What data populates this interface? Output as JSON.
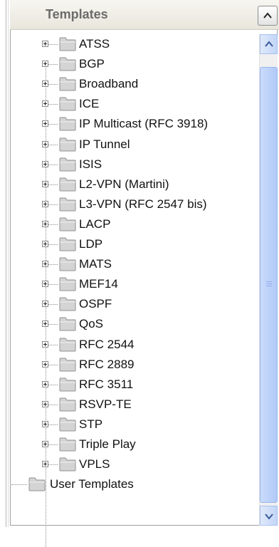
{
  "panel": {
    "title": "Templates",
    "collapse_icon": "chevron-up-icon"
  },
  "tree": {
    "items": [
      {
        "label": "ATSS",
        "icon": "folder-icon",
        "expander": "expand-plus-icon"
      },
      {
        "label": "BGP",
        "icon": "folder-icon",
        "expander": "expand-plus-icon"
      },
      {
        "label": "Broadband",
        "icon": "folder-icon",
        "expander": "expand-plus-icon"
      },
      {
        "label": "ICE",
        "icon": "folder-icon",
        "expander": "expand-plus-icon"
      },
      {
        "label": "IP Multicast (RFC 3918)",
        "icon": "folder-icon",
        "expander": "expand-plus-icon"
      },
      {
        "label": "IP Tunnel",
        "icon": "folder-icon",
        "expander": "expand-plus-icon"
      },
      {
        "label": "ISIS",
        "icon": "folder-icon",
        "expander": "expand-plus-icon"
      },
      {
        "label": "L2-VPN (Martini)",
        "icon": "folder-icon",
        "expander": "expand-plus-icon"
      },
      {
        "label": "L3-VPN (RFC 2547 bis)",
        "icon": "folder-icon",
        "expander": "expand-plus-icon"
      },
      {
        "label": "LACP",
        "icon": "folder-icon",
        "expander": "expand-plus-icon"
      },
      {
        "label": "LDP",
        "icon": "folder-icon",
        "expander": "expand-plus-icon"
      },
      {
        "label": "MATS",
        "icon": "folder-icon",
        "expander": "expand-plus-icon"
      },
      {
        "label": "MEF14",
        "icon": "folder-icon",
        "expander": "expand-plus-icon"
      },
      {
        "label": "OSPF",
        "icon": "folder-icon",
        "expander": "expand-plus-icon"
      },
      {
        "label": "QoS",
        "icon": "folder-icon",
        "expander": "expand-plus-icon"
      },
      {
        "label": "RFC 2544",
        "icon": "folder-icon",
        "expander": "expand-plus-icon"
      },
      {
        "label": "RFC 2889",
        "icon": "folder-icon",
        "expander": "expand-plus-icon"
      },
      {
        "label": "RFC 3511",
        "icon": "folder-icon",
        "expander": "expand-plus-icon"
      },
      {
        "label": "RSVP-TE",
        "icon": "folder-icon",
        "expander": "expand-plus-icon"
      },
      {
        "label": "STP",
        "icon": "folder-icon",
        "expander": "expand-plus-icon"
      },
      {
        "label": "Triple Play",
        "icon": "folder-icon",
        "expander": "expand-plus-icon"
      },
      {
        "label": "VPLS",
        "icon": "folder-icon",
        "expander": "expand-plus-icon"
      }
    ],
    "root_item": {
      "label": "User Templates",
      "icon": "folder-icon"
    }
  },
  "scrollbar": {
    "up_icon": "chevron-up-icon",
    "down_icon": "chevron-down-icon",
    "grip_icon": "grip-icon"
  },
  "colors": {
    "header_title": "#6b6b6b",
    "scroll_thumb": "#b1c9f7",
    "folder_fill": "#d4d4d4"
  }
}
